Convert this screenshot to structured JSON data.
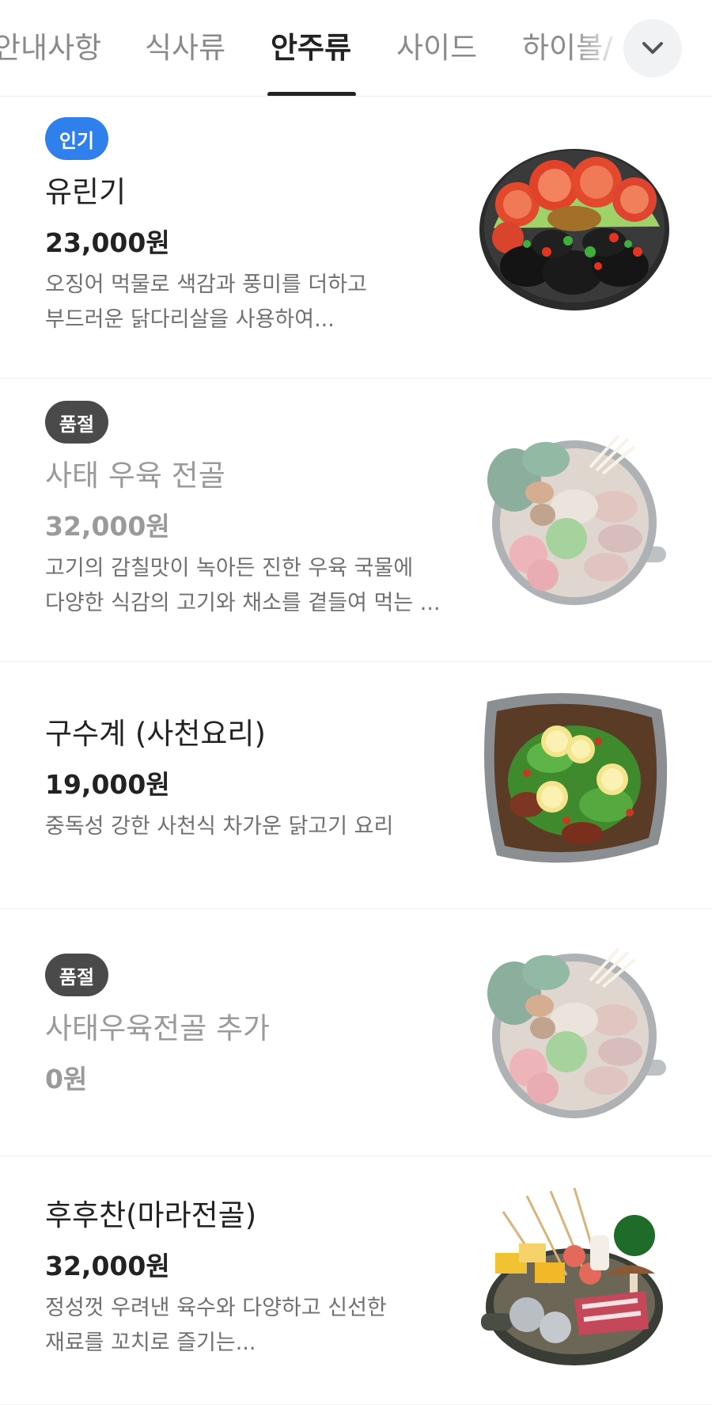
{
  "tabs": [
    {
      "label": "안내사항",
      "active": false
    },
    {
      "label": "식사류",
      "active": false
    },
    {
      "label": "안주류",
      "active": true
    },
    {
      "label": "사이드",
      "active": false
    },
    {
      "label": "하이볼/",
      "active": false
    }
  ],
  "menu_items": [
    {
      "badge": "인기",
      "name": "유린기",
      "price": "23,000원",
      "description_lines": [
        "오징어 먹물로 색감과 풍미를 더하고",
        "부드러운 닭다리살을 사용하여..."
      ],
      "image": "fried-chicken-with-tomato-dish"
    },
    {
      "badge": "품절",
      "name": "사태 우육 전골",
      "price": "32,000원",
      "description_lines": [
        "고기의 감칠맛이 녹아든 진한 우육 국물에",
        "다양한 식감의 고기와 채소를 곁들여 먹는 ..."
      ],
      "image": "beef-hotpot"
    },
    {
      "badge": "",
      "name": "구수계 (사천요리)",
      "price": "19,000원",
      "description_lines": [
        "중독성 강한 사천식 차가운 닭고기 요리"
      ],
      "image": "sichuan-chicken-salad"
    },
    {
      "badge": "품절",
      "name": "사태우육전골 추가",
      "price": "0원",
      "description_lines": [],
      "image": "beef-hotpot"
    },
    {
      "badge": "",
      "name": "후후찬(마라전골)",
      "price": "32,000원",
      "description_lines": [
        "정성껏 우려낸 육수와 다양하고 신선한",
        "재료를 꼬치로 즐기는..."
      ],
      "image": "mala-skewer-hotpot"
    }
  ],
  "colors": {
    "popular_badge": "#2f80ed",
    "soldout_badge": "#4a4a4a",
    "active_tab": "#222222",
    "inactive_tab": "#8a8a8a"
  },
  "icons": {
    "expand": "chevron-down-icon"
  }
}
